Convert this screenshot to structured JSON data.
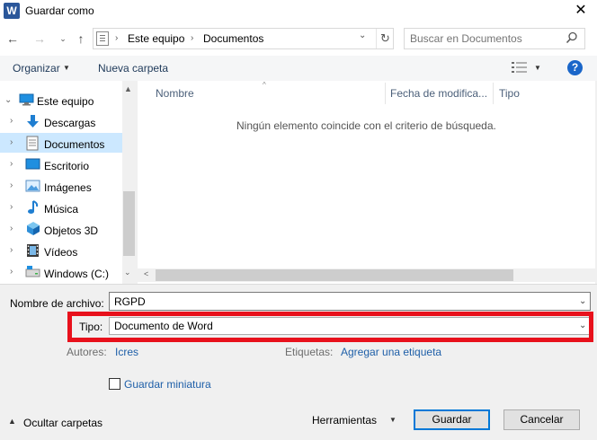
{
  "window": {
    "title": "Guardar como",
    "app_icon": "W",
    "close_glyph": "✕"
  },
  "nav": {
    "back_glyph": "←",
    "forward_glyph": "→",
    "recent_glyph": "⌄",
    "up_glyph": "↑",
    "separator": "›",
    "breadcrumbs": [
      "Este equipo",
      "Documentos"
    ],
    "address_dropdown_glyph": "⌄",
    "refresh_glyph": "↻",
    "search_placeholder": "Buscar en Documentos"
  },
  "toolbar": {
    "organize_label": "Organizar",
    "organize_caret": "▼",
    "new_folder_label": "Nueva carpeta",
    "view_caret": "▼",
    "help_glyph": "?"
  },
  "sidebar": {
    "items": [
      {
        "label": "Este equipo",
        "icon": "computer-icon",
        "chevron": "⌄"
      },
      {
        "label": "Descargas",
        "icon": "download-icon",
        "chevron": "›"
      },
      {
        "label": "Documentos",
        "icon": "document-icon",
        "chevron": "›",
        "selected": true
      },
      {
        "label": "Escritorio",
        "icon": "desktop-icon",
        "chevron": "›"
      },
      {
        "label": "Imágenes",
        "icon": "pictures-icon",
        "chevron": "›"
      },
      {
        "label": "Música",
        "icon": "music-icon",
        "chevron": "›"
      },
      {
        "label": "Objetos 3D",
        "icon": "objects-3d-icon",
        "chevron": "›"
      },
      {
        "label": "Vídeos",
        "icon": "videos-icon",
        "chevron": "›"
      },
      {
        "label": "Windows (C:)",
        "icon": "drive-icon",
        "chevron": "›"
      }
    ],
    "scroll_up_glyph": "▲",
    "scroll_down_glyph": "⌄"
  },
  "filelist": {
    "columns": [
      "Nombre",
      "Fecha de modifica...",
      "Tipo"
    ],
    "sort_glyph": "^",
    "empty_message": "Ningún elemento coincide con el criterio de búsqueda.",
    "scroll_left_glyph": "<"
  },
  "form": {
    "filename_label": "Nombre de archivo:",
    "filename_value": "RGPD",
    "type_label": "Tipo:",
    "type_value": "Documento de Word",
    "authors_label": "Autores:",
    "authors_value": "Icres",
    "tags_label": "Etiquetas:",
    "tags_value": "Agregar una etiqueta",
    "thumbnail_label": "Guardar miniatura",
    "thumbnail_checked": false,
    "dropdown_glyph": "⌄"
  },
  "footer": {
    "hide_folders_glyph": "▲",
    "hide_folders_label": "Ocultar carpetas",
    "tools_label": "Herramientas",
    "tools_caret": "▼",
    "save_label": "Guardar",
    "cancel_label": "Cancelar"
  },
  "colors": {
    "highlight": "#e8111c",
    "link": "#1e5fa8",
    "selection": "#cce8ff",
    "help_blue": "#1a66c9"
  }
}
